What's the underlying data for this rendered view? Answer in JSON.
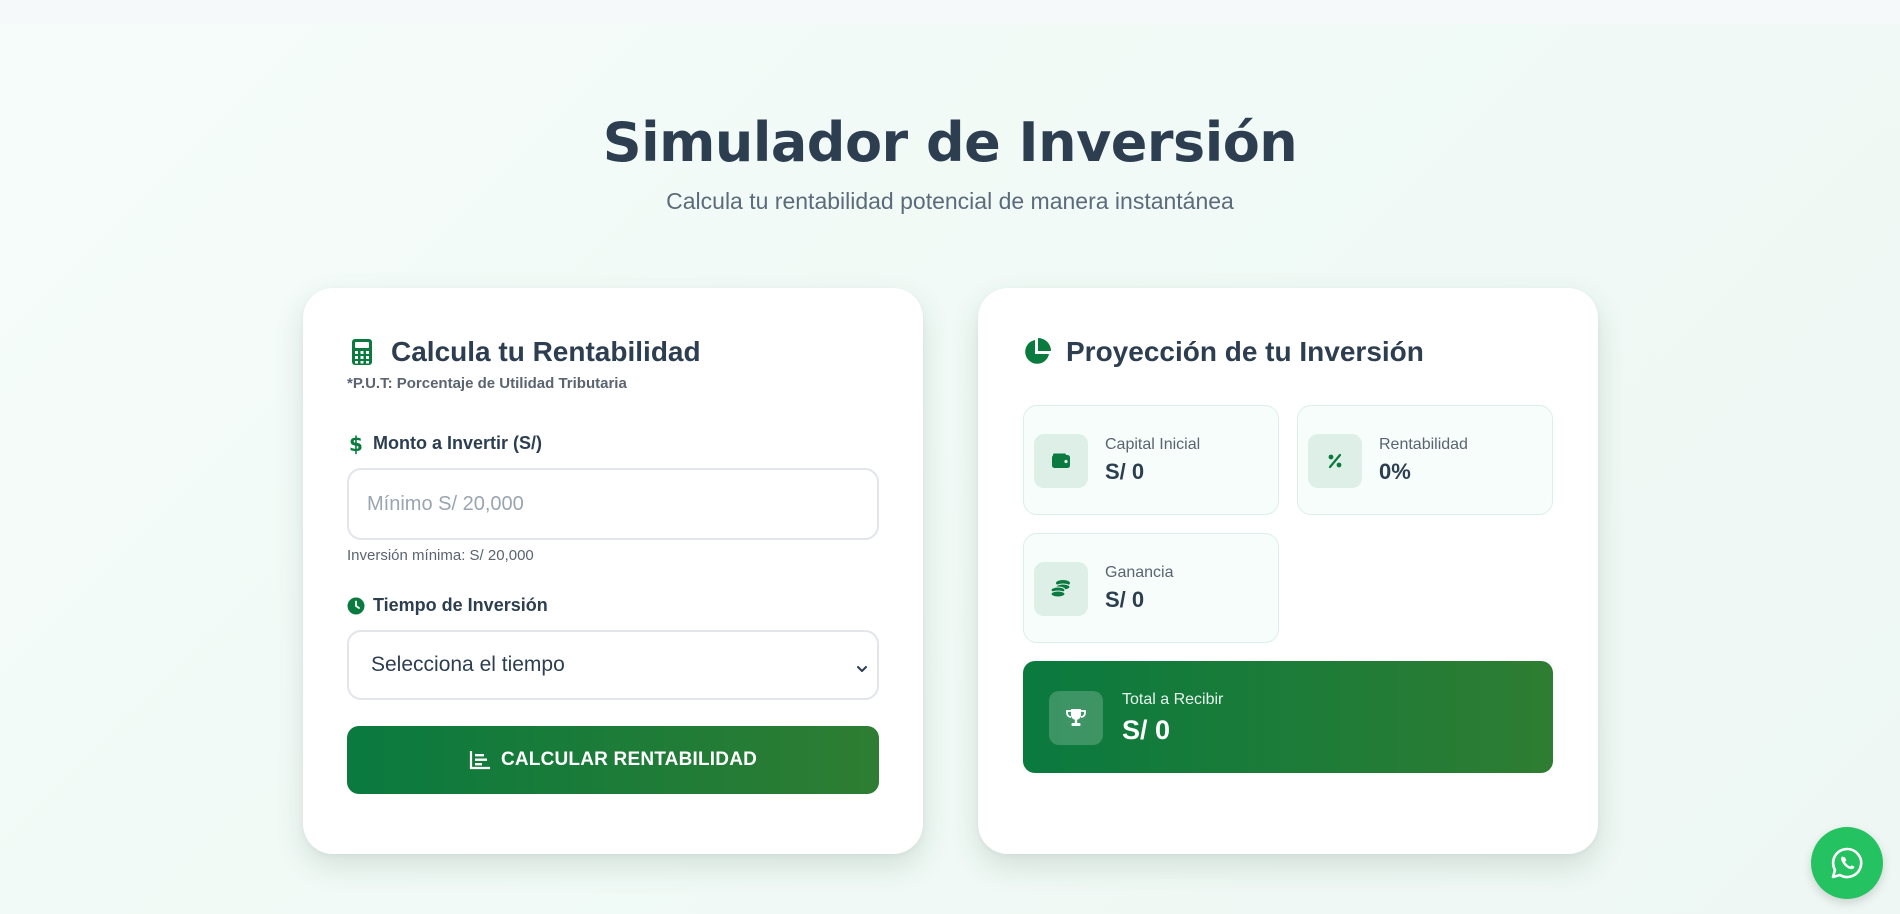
{
  "hero": {
    "title": "Simulador de Inversión",
    "subtitle": "Calcula tu rentabilidad potencial de manera instantánea"
  },
  "calculator": {
    "title": "Calcula tu Rentabilidad",
    "note": "*P.U.T: Porcentaje de Utilidad Tributaria",
    "amount_label": "Monto a Invertir (S/)",
    "amount_value": "",
    "amount_placeholder": "Mínimo S/ 20,000",
    "amount_hint": "Inversión mínima: S/ 20,000",
    "time_label": "Tiempo de Inversión",
    "time_selected": "Selecciona el tiempo",
    "button_label": "CALCULAR RENTABILIDAD"
  },
  "projection": {
    "title": "Proyección de tu Inversión",
    "capital_label": "Capital Inicial",
    "capital_value": "S/ 0",
    "rent_label": "Rentabilidad",
    "rent_value": "0%",
    "gain_label": "Ganancia",
    "gain_value": "S/ 0",
    "total_label": "Total a Recibir",
    "total_value": "S/ 0"
  },
  "icons": {
    "calculator": "calculator-icon",
    "dollar": "dollar-icon",
    "clock": "clock-icon",
    "chart": "chart-bar-icon",
    "pie": "pie-chart-icon",
    "wallet": "wallet-icon",
    "percent": "percent-icon",
    "coins": "coins-icon",
    "trophy": "trophy-icon",
    "whatsapp": "whatsapp-icon"
  },
  "colors": {
    "primary": "#0a7a3f",
    "primary_end": "#2e7d32",
    "text": "#2c3e50",
    "whatsapp": "#25c261"
  }
}
